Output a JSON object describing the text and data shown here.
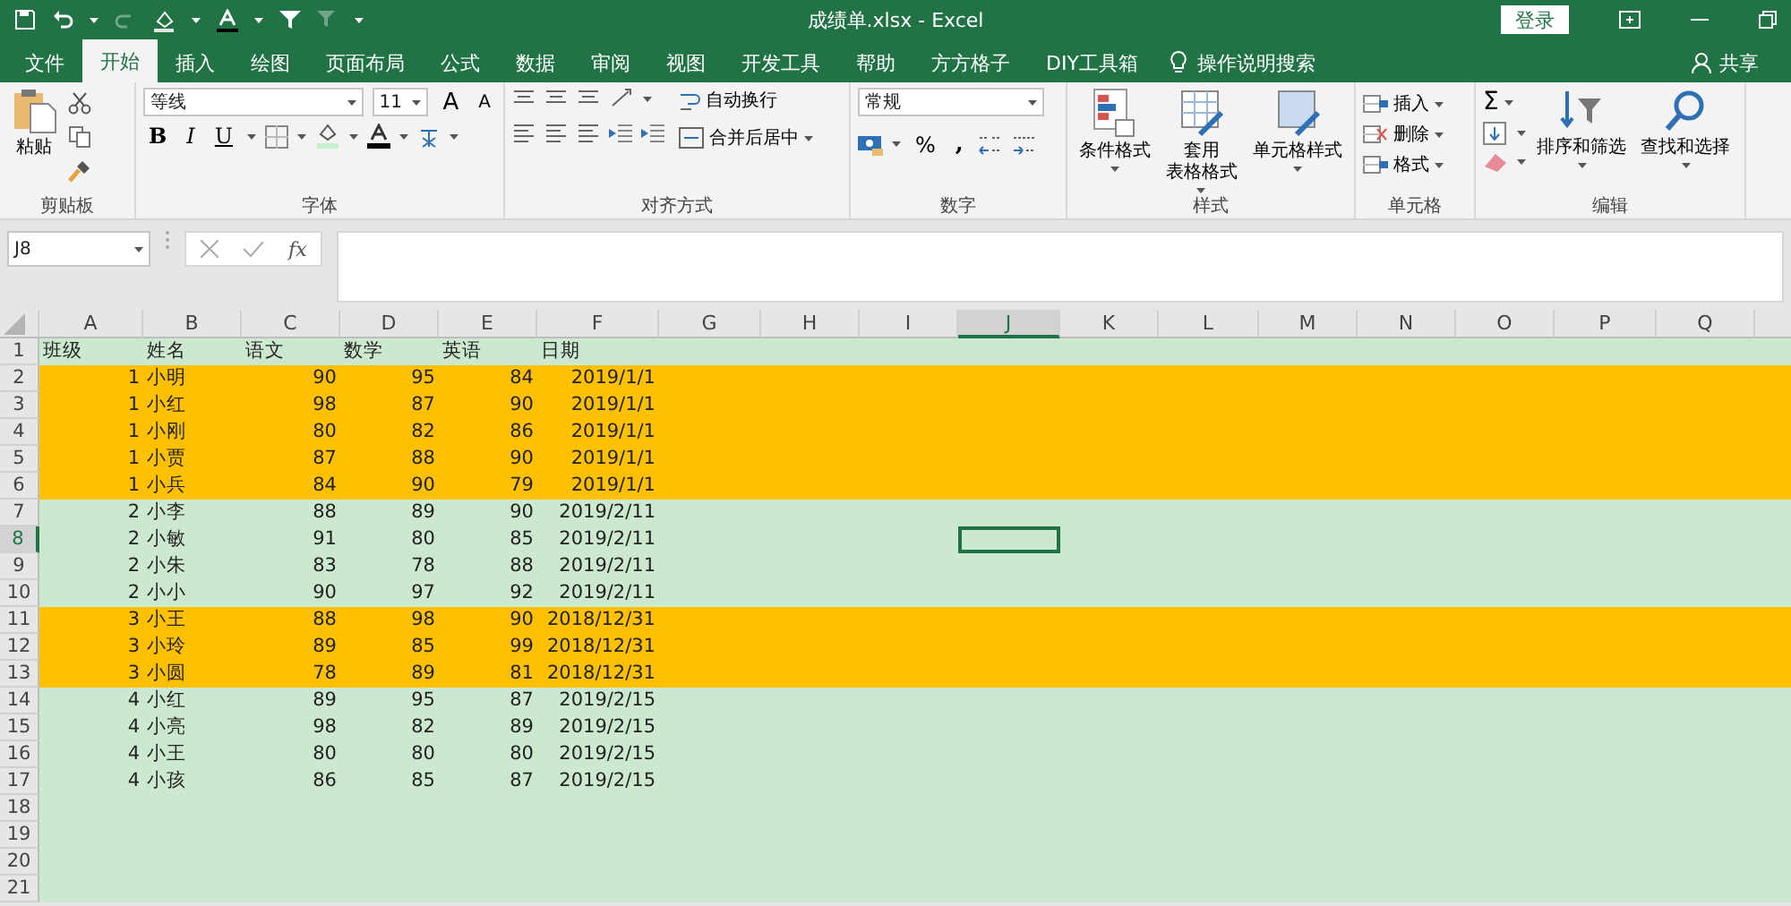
{
  "window": {
    "title": "成绩单.xlsx  -  Excel",
    "login": "登录"
  },
  "tabs": [
    {
      "label": "文件",
      "selected": false
    },
    {
      "label": "开始",
      "selected": true
    },
    {
      "label": "插入",
      "selected": false
    },
    {
      "label": "绘图",
      "selected": false
    },
    {
      "label": "页面布局",
      "selected": false
    },
    {
      "label": "公式",
      "selected": false
    },
    {
      "label": "数据",
      "selected": false
    },
    {
      "label": "审阅",
      "selected": false
    },
    {
      "label": "视图",
      "selected": false
    },
    {
      "label": "开发工具",
      "selected": false
    },
    {
      "label": "帮助",
      "selected": false
    },
    {
      "label": "方方格子",
      "selected": false
    },
    {
      "label": "DIY工具箱",
      "selected": false
    }
  ],
  "tell_me": "操作说明搜索",
  "share": "共享",
  "ribbon": {
    "clipboard": {
      "paste": "粘贴",
      "label": "剪贴板"
    },
    "font": {
      "name": "等线",
      "size": "11",
      "grow": "A",
      "shrink": "A",
      "styles": [
        "B",
        "I",
        "U"
      ],
      "label": "字体"
    },
    "alignment": {
      "wrap": "自动换行",
      "merge": "合并后居中",
      "label": "对齐方式"
    },
    "number": {
      "format": "常规",
      "percent": "%",
      "comma": ",",
      "label": "数字"
    },
    "styles": {
      "buttons": [
        [
          "条件格式"
        ],
        [
          "套用",
          "表格格式"
        ],
        [
          "单元格样式"
        ]
      ],
      "label": "样式"
    },
    "cells": {
      "buttons": [
        "插入",
        "删除",
        "格式"
      ],
      "label": "单元格"
    },
    "editing": {
      "sum": "Σ",
      "buttons": [
        "排序和筛选",
        "查找和选择"
      ],
      "label": "编辑"
    }
  },
  "formula_bar": {
    "name_box": "J8",
    "fx": "fx"
  },
  "columns": [
    {
      "label": "A",
      "selected": false
    },
    {
      "label": "B",
      "selected": false
    },
    {
      "label": "C",
      "selected": false
    },
    {
      "label": "D",
      "selected": false
    },
    {
      "label": "E",
      "selected": false
    },
    {
      "label": "F",
      "selected": false
    },
    {
      "label": "G",
      "selected": false
    },
    {
      "label": "H",
      "selected": false
    },
    {
      "label": "I",
      "selected": false
    },
    {
      "label": "J",
      "selected": true
    },
    {
      "label": "K",
      "selected": false
    },
    {
      "label": "L",
      "selected": false
    },
    {
      "label": "M",
      "selected": false
    },
    {
      "label": "N",
      "selected": false
    },
    {
      "label": "O",
      "selected": false
    },
    {
      "label": "P",
      "selected": false
    },
    {
      "label": "Q",
      "selected": false
    }
  ],
  "rows": [
    {
      "number": "1",
      "kind": "header",
      "color": "#cce8cf",
      "selected": false,
      "cells": [
        "班级",
        "姓名",
        "语文",
        "数学",
        "英语",
        "日期"
      ]
    },
    {
      "number": "2",
      "kind": "data",
      "color": "#ffc000",
      "selected": false,
      "cells": [
        "1",
        "小明",
        "90",
        "95",
        "84",
        "2019/1/1"
      ]
    },
    {
      "number": "3",
      "kind": "data",
      "color": "#ffc000",
      "selected": false,
      "cells": [
        "1",
        "小红",
        "98",
        "87",
        "90",
        "2019/1/1"
      ]
    },
    {
      "number": "4",
      "kind": "data",
      "color": "#ffc000",
      "selected": false,
      "cells": [
        "1",
        "小刚",
        "80",
        "82",
        "86",
        "2019/1/1"
      ]
    },
    {
      "number": "5",
      "kind": "data",
      "color": "#ffc000",
      "selected": false,
      "cells": [
        "1",
        "小贾",
        "87",
        "88",
        "90",
        "2019/1/1"
      ]
    },
    {
      "number": "6",
      "kind": "data",
      "color": "#ffc000",
      "selected": false,
      "cells": [
        "1",
        "小兵",
        "84",
        "90",
        "79",
        "2019/1/1"
      ]
    },
    {
      "number": "7",
      "kind": "data",
      "color": "#cce8cf",
      "selected": false,
      "cells": [
        "2",
        "小李",
        "88",
        "89",
        "90",
        "2019/2/11"
      ]
    },
    {
      "number": "8",
      "kind": "data",
      "color": "#cce8cf",
      "selected": true,
      "cells": [
        "2",
        "小敏",
        "91",
        "80",
        "85",
        "2019/2/11"
      ]
    },
    {
      "number": "9",
      "kind": "data",
      "color": "#cce8cf",
      "selected": false,
      "cells": [
        "2",
        "小朱",
        "83",
        "78",
        "88",
        "2019/2/11"
      ]
    },
    {
      "number": "10",
      "kind": "data",
      "color": "#cce8cf",
      "selected": false,
      "cells": [
        "2",
        "小小",
        "90",
        "97",
        "92",
        "2019/2/11"
      ]
    },
    {
      "number": "11",
      "kind": "data",
      "color": "#ffc000",
      "selected": false,
      "cells": [
        "3",
        "小王",
        "88",
        "98",
        "90",
        "2018/12/31"
      ]
    },
    {
      "number": "12",
      "kind": "data",
      "color": "#ffc000",
      "selected": false,
      "cells": [
        "3",
        "小玲",
        "89",
        "85",
        "99",
        "2018/12/31"
      ]
    },
    {
      "number": "13",
      "kind": "data",
      "color": "#ffc000",
      "selected": false,
      "cells": [
        "3",
        "小圆",
        "78",
        "89",
        "81",
        "2018/12/31"
      ]
    },
    {
      "number": "14",
      "kind": "data",
      "color": "#cce8cf",
      "selected": false,
      "cells": [
        "4",
        "小红",
        "89",
        "95",
        "87",
        "2019/2/15"
      ]
    },
    {
      "number": "15",
      "kind": "data",
      "color": "#cce8cf",
      "selected": false,
      "cells": [
        "4",
        "小亮",
        "98",
        "82",
        "89",
        "2019/2/15"
      ]
    },
    {
      "number": "16",
      "kind": "data",
      "color": "#cce8cf",
      "selected": false,
      "cells": [
        "4",
        "小王",
        "80",
        "80",
        "80",
        "2019/2/15"
      ]
    },
    {
      "number": "17",
      "kind": "data",
      "color": "#cce8cf",
      "selected": false,
      "cells": [
        "4",
        "小孩",
        "86",
        "85",
        "87",
        "2019/2/15"
      ]
    },
    {
      "number": "18",
      "kind": "empty",
      "color": "#cce8cf",
      "selected": false
    },
    {
      "number": "19",
      "kind": "empty",
      "color": "#cce8cf",
      "selected": false
    },
    {
      "number": "20",
      "kind": "empty",
      "color": "#cce8cf",
      "selected": false
    },
    {
      "number": "21",
      "kind": "empty",
      "color": "#cce8cf",
      "selected": false
    }
  ]
}
